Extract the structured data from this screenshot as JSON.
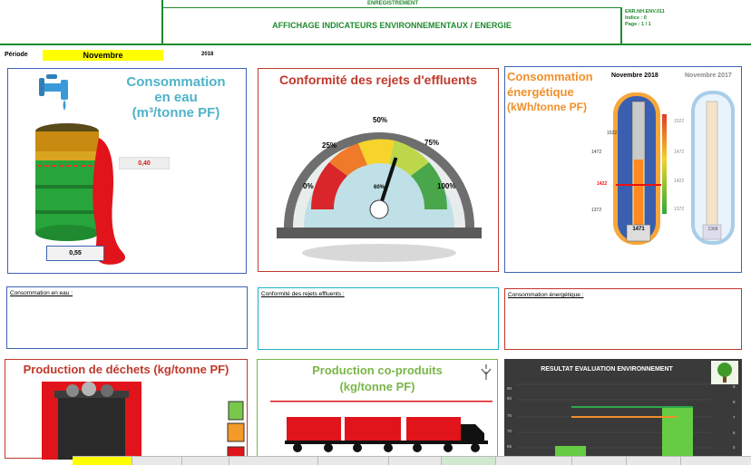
{
  "header": {
    "register_label": "ENREGISTREMENT",
    "title": "AFFICHAGE INDICATEURS ENVIRONNEMENTAUX / ENERGIE",
    "doc_ref": "ENR.NH.ENV.011",
    "indice": "Indice : 0",
    "page": "Page : 1 / 1"
  },
  "period": {
    "label": "Période",
    "month": "Novembre",
    "year": "2018"
  },
  "water": {
    "title_line1": "Consommation",
    "title_line2": "en eau",
    "title_line3": "(m³/tonne PF)",
    "target": "0,40",
    "value": "0,55"
  },
  "effluent": {
    "title": "Conformité des rejets d'effluents",
    "ticks": [
      "0%",
      "25%",
      "50%",
      "75%",
      "100%"
    ],
    "value_label": "60%",
    "value": 0.6
  },
  "energy": {
    "title_line1": "Consommation",
    "title_line2": "énergétique",
    "title_line3": "(kWh/tonne PF)",
    "col1_label": "Novembre 2018",
    "col2_label": "Novembre 2017",
    "scale": [
      "1522",
      "1472",
      "1422",
      "1372"
    ],
    "value_2018": "1471",
    "value_2017": "1368",
    "target": "1422"
  },
  "comments": {
    "water": "Consommation en eau :",
    "effluent": "Conformité des rejets effluents :",
    "energy": "Consommation énergétique :"
  },
  "waste": {
    "title": "Production de déchets (kg/tonne PF)"
  },
  "coproducts": {
    "title_line1": "Production co-produits",
    "title_line2": "(kg/tonne PF)"
  },
  "env_result": {
    "title": "RESULTAT EVALUATION ENVIRONNEMENT",
    "left_axis": [
      "90",
      "80",
      "75",
      "70",
      "65",
      "60"
    ],
    "right_axis": [
      "9",
      "8",
      "7",
      "6",
      "5",
      "4"
    ]
  },
  "colors": {
    "header_green": "#1e8a2e",
    "water_title": "#4fb3c8",
    "effluent_title": "#c0392b",
    "energy_title": "#f0902a",
    "waste_title": "#c0392b",
    "coproducts_title": "#7ab648"
  }
}
